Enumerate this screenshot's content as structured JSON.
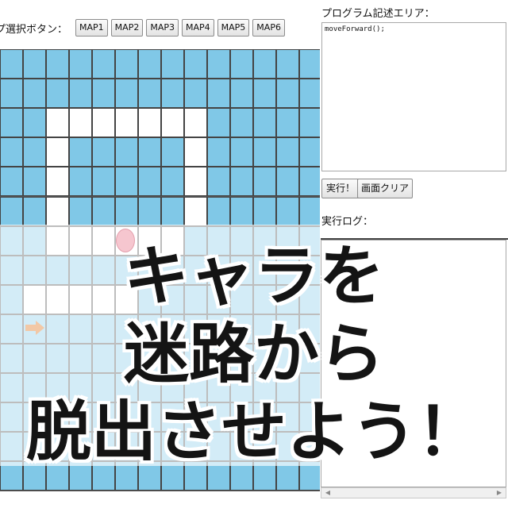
{
  "map_select": {
    "label": "プ選択ボタン：",
    "buttons": [
      "MAP1",
      "MAP2",
      "MAP3",
      "MAP4",
      "MAP5",
      "MAP6"
    ]
  },
  "maze": {
    "rows": [
      "##############",
      "##############",
      "##.......#####",
      "##.#####.#####",
      "##.#####.#####",
      "##.#####.#####",
      "##.....G######",
      "##############",
      "#.S...########",
      "##############",
      "##############",
      "##############",
      "##############",
      "##############",
      "##############"
    ],
    "wall_color": "#80c8e7",
    "path_color": "#ffffff",
    "goal_color": "#f6c6cf",
    "start_color": "#f2c8a6"
  },
  "editor": {
    "title": "プログラム記述エリア：",
    "code": "moveForward();"
  },
  "controls": {
    "run_label": "実行！",
    "clear_label": "画面クリア"
  },
  "log": {
    "title": "実行ログ：",
    "content": ""
  },
  "headline": {
    "lines": [
      "キャラを",
      "迷路から",
      "脱出させよう！"
    ]
  }
}
